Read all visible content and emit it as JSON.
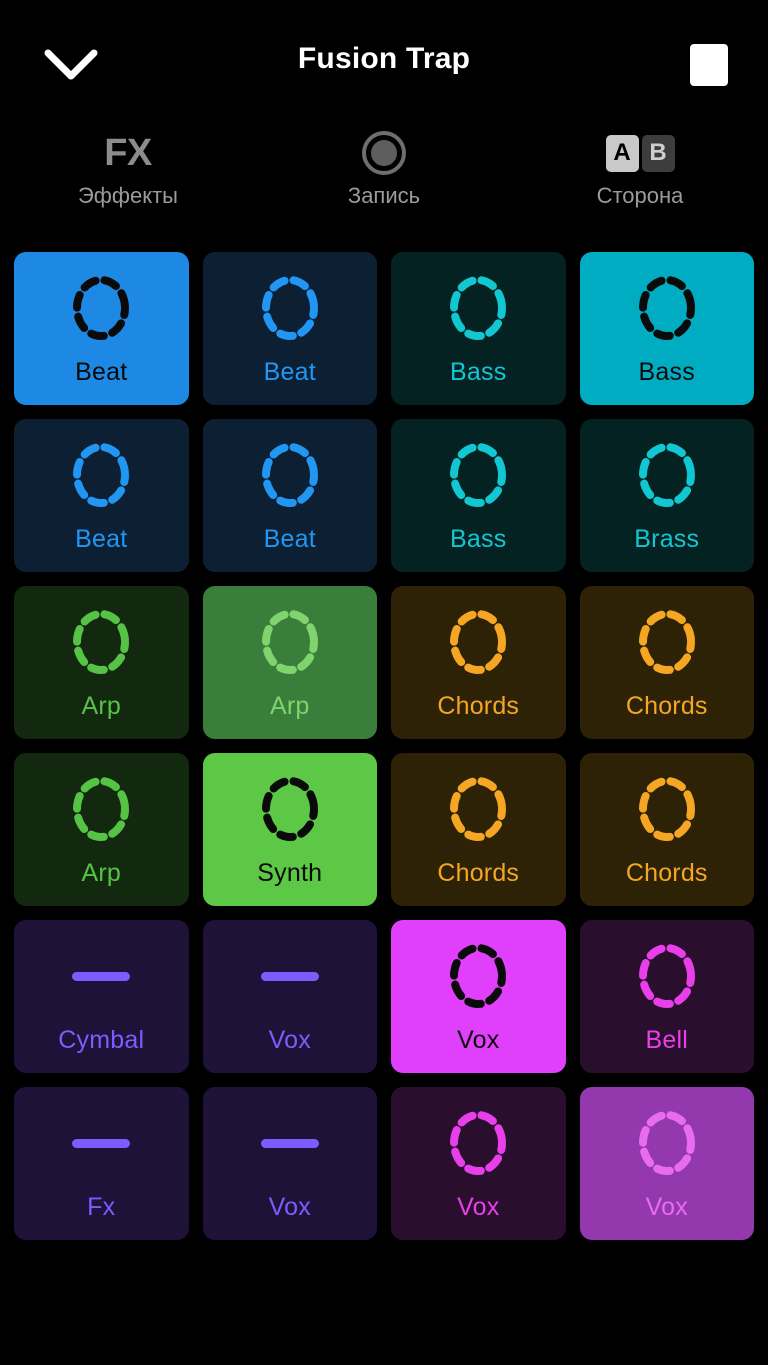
{
  "header": {
    "title": "Fusion Trap",
    "collapse_icon": "chevron-down-icon",
    "stop_icon": "stop-square-icon"
  },
  "toolbar": [
    {
      "glyph": "FX",
      "icon_name": "fx-icon",
      "label": "Эффекты"
    },
    {
      "glyph": "",
      "icon_name": "record-icon",
      "label": "Запись"
    },
    {
      "glyph": "AB",
      "icon_name": "ab-side-icon",
      "label": "Сторона",
      "a_label": "A",
      "b_label": "B",
      "a_active": true,
      "b_active": false
    }
  ],
  "colors": {
    "background": "#000000",
    "blue_active": "#1E88E5",
    "blue_dark": "#0D1F33",
    "blue_accent": "#2196F3",
    "cyan_active": "#00ACC1",
    "cyan_dark": "#042222",
    "cyan_accent": "#11C7D1",
    "green_bright": "#5CC846",
    "green_mid": "#3A7E3C",
    "green_dark": "#13290F",
    "green_accent": "#56C246",
    "amber_dark": "#2D2206",
    "amber_accent": "#F5A623",
    "indigo_dark": "#1E1238",
    "violet_accent": "#7C5CFF",
    "magenta_active": "#E040FB",
    "magenta_dark": "#2A0E2E",
    "magenta_accent": "#E83FEA",
    "purple_mid": "#9438AD",
    "dark_ring": "#0A0A0A",
    "dark_text": "#0A0A0A"
  },
  "pads": [
    {
      "label": "Beat",
      "icon": "dashed-ring-icon",
      "bg": "#1E88E5",
      "fg": "#0A0A0A",
      "state": "active"
    },
    {
      "label": "Beat",
      "icon": "dashed-ring-icon",
      "bg": "#0D1F33",
      "fg": "#2196F3",
      "state": "idle"
    },
    {
      "label": "Bass",
      "icon": "dashed-ring-icon",
      "bg": "#042222",
      "fg": "#11C7D1",
      "state": "idle"
    },
    {
      "label": "Bass",
      "icon": "dashed-ring-icon",
      "bg": "#00ACC1",
      "fg": "#0A0A0A",
      "state": "active"
    },
    {
      "label": "Beat",
      "icon": "dashed-ring-icon",
      "bg": "#0D1F33",
      "fg": "#2196F3",
      "state": "idle"
    },
    {
      "label": "Beat",
      "icon": "dashed-ring-icon",
      "bg": "#0D1F33",
      "fg": "#2196F3",
      "state": "idle"
    },
    {
      "label": "Bass",
      "icon": "dashed-ring-icon",
      "bg": "#042222",
      "fg": "#11C7D1",
      "state": "idle"
    },
    {
      "label": "Brass",
      "icon": "dashed-ring-icon",
      "bg": "#042222",
      "fg": "#11C7D1",
      "state": "idle"
    },
    {
      "label": "Arp",
      "icon": "dashed-ring-icon",
      "bg": "#13290F",
      "fg": "#56C246",
      "state": "idle"
    },
    {
      "label": "Arp",
      "icon": "dashed-ring-icon",
      "bg": "#3A7E3C",
      "fg": "#7FD46E",
      "state": "queued"
    },
    {
      "label": "Chords",
      "icon": "dashed-ring-icon",
      "bg": "#2D2206",
      "fg": "#F5A623",
      "state": "idle"
    },
    {
      "label": "Chords",
      "icon": "dashed-ring-icon",
      "bg": "#2D2206",
      "fg": "#F5A623",
      "state": "idle"
    },
    {
      "label": "Arp",
      "icon": "dashed-ring-icon",
      "bg": "#13290F",
      "fg": "#56C246",
      "state": "idle"
    },
    {
      "label": "Synth",
      "icon": "dashed-ring-icon",
      "bg": "#5CC846",
      "fg": "#0A0A0A",
      "state": "active"
    },
    {
      "label": "Chords",
      "icon": "dashed-ring-icon",
      "bg": "#2D2206",
      "fg": "#F5A623",
      "state": "idle"
    },
    {
      "label": "Chords",
      "icon": "dashed-ring-icon",
      "bg": "#2D2206",
      "fg": "#F5A623",
      "state": "idle"
    },
    {
      "label": "Cymbal",
      "icon": "one-shot-bar-icon",
      "bg": "#1E1238",
      "fg": "#7C5CFF",
      "state": "idle"
    },
    {
      "label": "Vox",
      "icon": "one-shot-bar-icon",
      "bg": "#1E1238",
      "fg": "#7C5CFF",
      "state": "idle"
    },
    {
      "label": "Vox",
      "icon": "dashed-ring-icon",
      "bg": "#E040FB",
      "fg": "#0A0A0A",
      "state": "active"
    },
    {
      "label": "Bell",
      "icon": "dashed-ring-icon",
      "bg": "#2A0E2E",
      "fg": "#E83FEA",
      "state": "idle"
    },
    {
      "label": "Fx",
      "icon": "one-shot-bar-icon",
      "bg": "#1E1238",
      "fg": "#7C5CFF",
      "state": "idle"
    },
    {
      "label": "Vox",
      "icon": "one-shot-bar-icon",
      "bg": "#1E1238",
      "fg": "#7C5CFF",
      "state": "idle"
    },
    {
      "label": "Vox",
      "icon": "dashed-ring-icon",
      "bg": "#2A0E2E",
      "fg": "#E83FEA",
      "state": "idle"
    },
    {
      "label": "Vox",
      "icon": "dashed-ring-icon",
      "bg": "#9438AD",
      "fg": "#E96BF0",
      "state": "queued"
    }
  ]
}
